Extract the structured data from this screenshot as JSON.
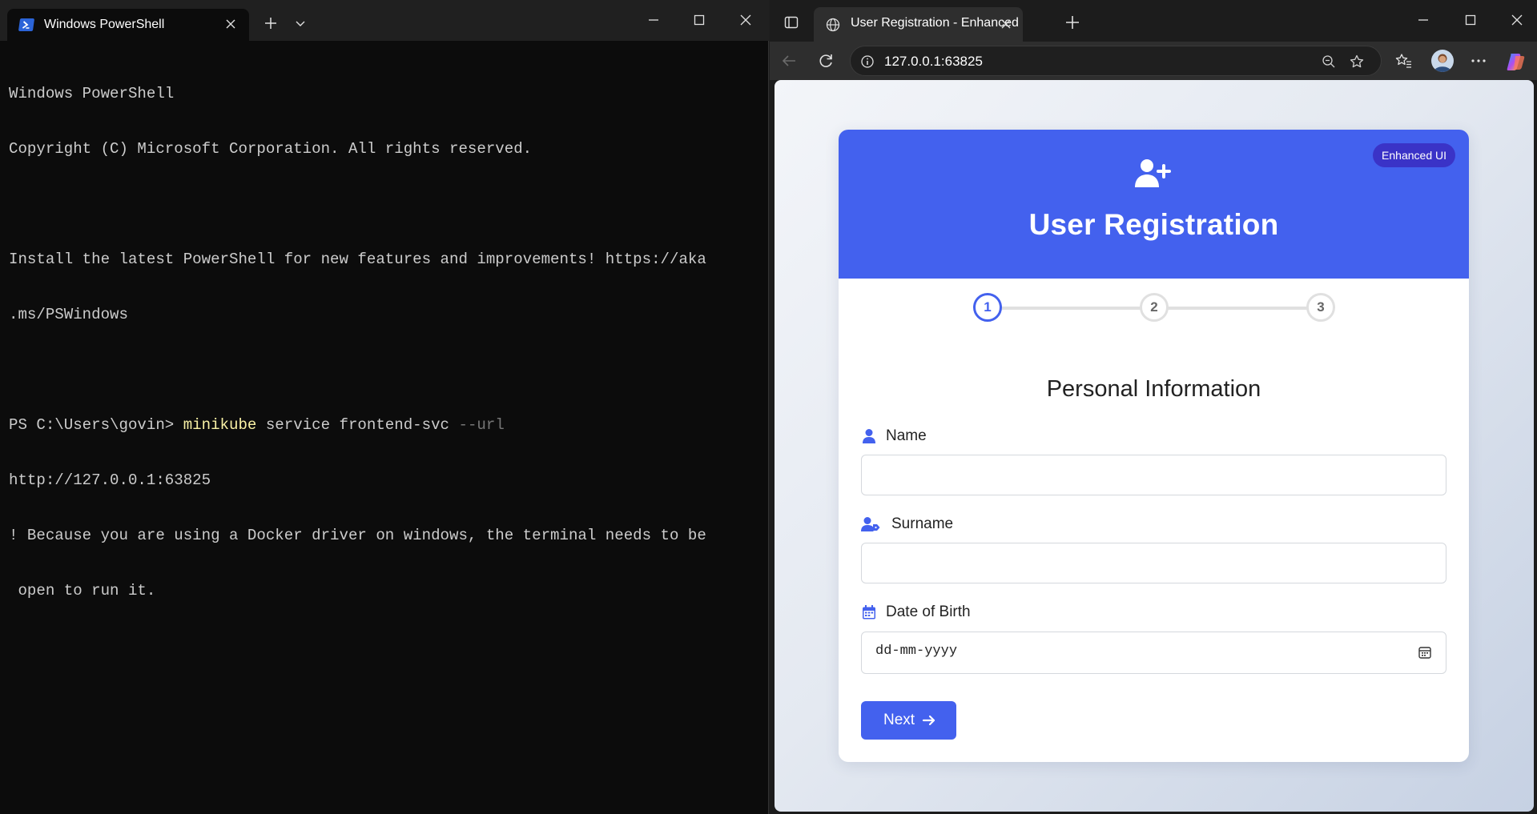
{
  "terminal": {
    "tab_title": "Windows PowerShell",
    "lines": [
      "Windows PowerShell",
      "Copyright (C) Microsoft Corporation. All rights reserved.",
      "",
      "Install the latest PowerShell for new features and improvements! https://aka",
      ".ms/PSWindows",
      ""
    ],
    "prompt": "PS C:\\Users\\govin> ",
    "cmd_name": "minikube",
    "cmd_args": " service frontend-svc ",
    "cmd_flag": "--url",
    "output_lines": [
      "http://127.0.0.1:63825",
      "! Because you are using a Docker driver on windows, the terminal needs to be",
      " open to run it."
    ]
  },
  "browser": {
    "tab_title": "User Registration - Enhanced",
    "address": "127.0.0.1:63825"
  },
  "page": {
    "badge": "Enhanced UI",
    "title": "User Registration",
    "steps": [
      "1",
      "2",
      "3"
    ],
    "active_step": 1,
    "section_title": "Personal Information",
    "fields": {
      "name_label": "Name",
      "name_value": "",
      "surname_label": "Surname",
      "surname_value": "",
      "dob_label": "Date of Birth",
      "dob_placeholder": "dd-mm-yyyy"
    },
    "next_label": "Next",
    "accent_color": "#4361ee",
    "badge_color": "#3a33c7"
  }
}
